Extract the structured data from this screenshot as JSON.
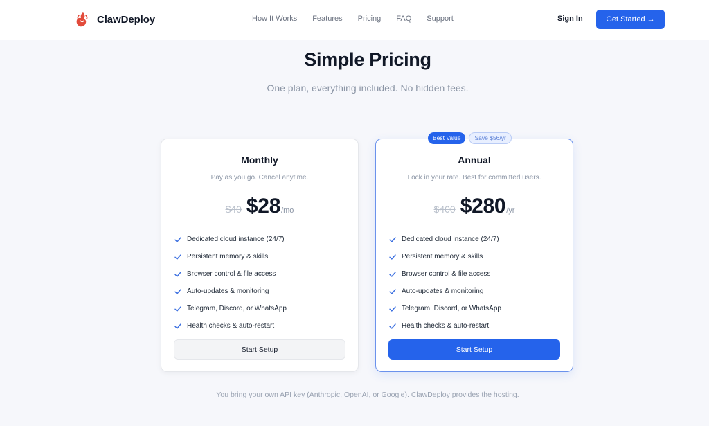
{
  "nav": {
    "brand": "ClawDeploy",
    "links": [
      "How It Works",
      "Features",
      "Pricing",
      "FAQ",
      "Support"
    ],
    "sign_in": "Sign In",
    "get_started": "Get Started →"
  },
  "header": {
    "title": "Simple Pricing",
    "subtitle": "One plan, everything included. No hidden fees."
  },
  "plans": [
    {
      "name": "Monthly",
      "description": "Pay as you go. Cancel anytime.",
      "old_price": "$40",
      "price": "$28",
      "period": "/mo",
      "features": [
        "Dedicated cloud instance (24/7)",
        "Persistent memory & skills",
        "Browser control & file access",
        "Auto-updates & monitoring",
        "Telegram, Discord, or WhatsApp",
        "Health checks & auto-restart"
      ],
      "button": "Start Setup"
    },
    {
      "name": "Annual",
      "description": "Lock in your rate. Best for committed users.",
      "old_price": "$400",
      "price": "$280",
      "period": "/yr",
      "badges": [
        "Best Value",
        "Save $56/yr"
      ],
      "features": [
        "Dedicated cloud instance (24/7)",
        "Persistent memory & skills",
        "Browser control & file access",
        "Auto-updates & monitoring",
        "Telegram, Discord, or WhatsApp",
        "Health checks & auto-restart"
      ],
      "button": "Start Setup"
    }
  ],
  "footnote": "You bring your own API key (Anthropic, OpenAI, or Google). ClawDeploy provides the hosting.",
  "colors": {
    "accent": "#2563eb",
    "brand_icon": "#e24b3b",
    "check": "#3b6fe0"
  },
  "icons": {
    "brand": "claw-logo-icon",
    "feature": "check-icon"
  }
}
